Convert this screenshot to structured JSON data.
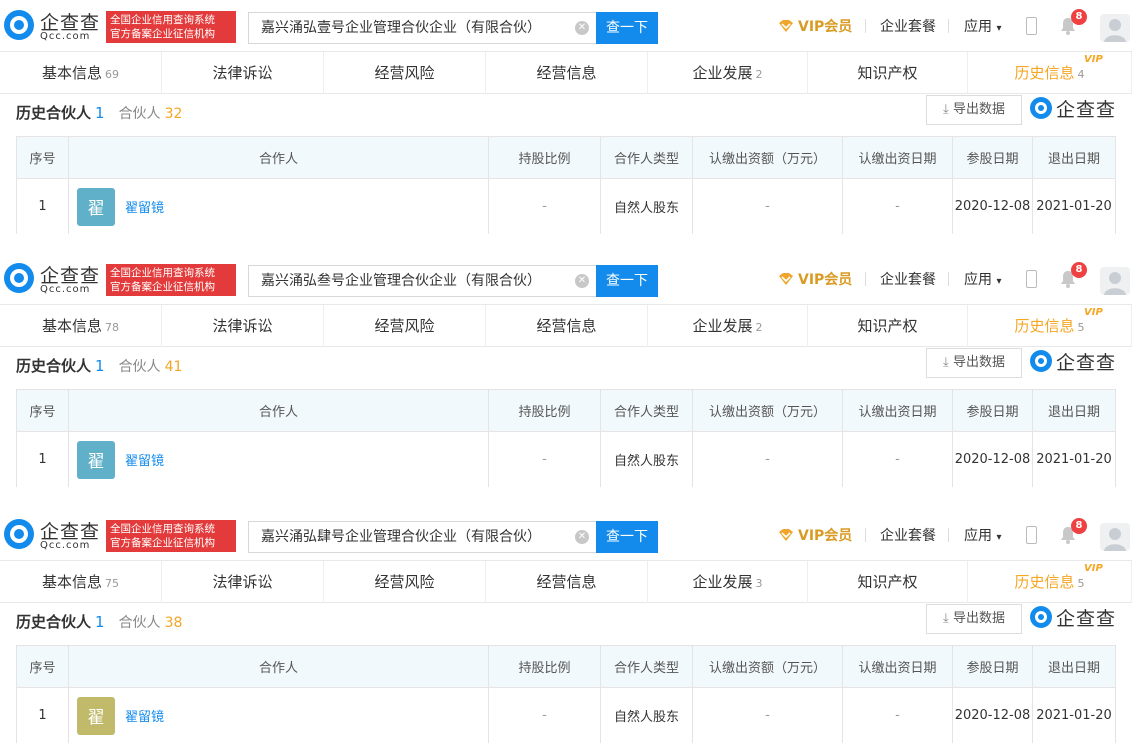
{
  "common": {
    "logo_cn": "企查查",
    "logo_en": "Qcc.com",
    "cert_line1": "全国企业信用查询系统",
    "cert_line2": "官方备案企业征信机构",
    "search_button": "查一下",
    "vip_label": "VIP会员",
    "package_link": "企业套餐",
    "apps_link": "应用",
    "notification_count": "8",
    "vip_sup": "VIP",
    "export_label": "导出数据",
    "watermark": "企查查",
    "section_title": "历史合伙人",
    "partners_label": "合伙人",
    "columns": [
      "序号",
      "合作人",
      "持股比例",
      "合作人类型",
      "认缴出资额（万元）",
      "认缴出资日期",
      "参股日期",
      "退出日期"
    ],
    "colors": {
      "brand_blue": "#128bed",
      "cert_red": "#e33b3b",
      "vip_gold": "#d89b23",
      "active_orange": "#f5a623"
    }
  },
  "panels": [
    {
      "search_value": "嘉兴涌弘壹号企业管理合伙企业（有限合伙）",
      "tabs": [
        {
          "label": "基本信息",
          "count": "69"
        },
        {
          "label": "法律诉讼",
          "count": ""
        },
        {
          "label": "经营风险",
          "count": ""
        },
        {
          "label": "经营信息",
          "count": ""
        },
        {
          "label": "企业发展",
          "count": "2"
        },
        {
          "label": "知识产权",
          "count": ""
        },
        {
          "label": "历史信息",
          "count": "4"
        }
      ],
      "history_count": "1",
      "partner_count": "32",
      "row": {
        "index": "1",
        "avatar_char": "翟",
        "avatar_color": "#5fb0c8",
        "name": "翟留镜",
        "ratio": "-",
        "type": "自然人股东",
        "amount": "-",
        "date": "-",
        "join_date": "2020-12-08",
        "exit_date": "2021-01-20"
      }
    },
    {
      "search_value": "嘉兴涌弘叁号企业管理合伙企业（有限合伙）",
      "tabs": [
        {
          "label": "基本信息",
          "count": "78"
        },
        {
          "label": "法律诉讼",
          "count": ""
        },
        {
          "label": "经营风险",
          "count": ""
        },
        {
          "label": "经营信息",
          "count": ""
        },
        {
          "label": "企业发展",
          "count": "2"
        },
        {
          "label": "知识产权",
          "count": ""
        },
        {
          "label": "历史信息",
          "count": "5"
        }
      ],
      "history_count": "1",
      "partner_count": "41",
      "row": {
        "index": "1",
        "avatar_char": "翟",
        "avatar_color": "#5fb0c8",
        "name": "翟留镜",
        "ratio": "-",
        "type": "自然人股东",
        "amount": "-",
        "date": "-",
        "join_date": "2020-12-08",
        "exit_date": "2021-01-20"
      }
    },
    {
      "search_value": "嘉兴涌弘肆号企业管理合伙企业（有限合伙）",
      "tabs": [
        {
          "label": "基本信息",
          "count": "75"
        },
        {
          "label": "法律诉讼",
          "count": ""
        },
        {
          "label": "经营风险",
          "count": ""
        },
        {
          "label": "经营信息",
          "count": ""
        },
        {
          "label": "企业发展",
          "count": "3"
        },
        {
          "label": "知识产权",
          "count": ""
        },
        {
          "label": "历史信息",
          "count": "5"
        }
      ],
      "history_count": "1",
      "partner_count": "38",
      "row": {
        "index": "1",
        "avatar_char": "翟",
        "avatar_color": "#c2ba6b",
        "name": "翟留镜",
        "ratio": "-",
        "type": "自然人股东",
        "amount": "-",
        "date": "-",
        "join_date": "2020-12-08",
        "exit_date": "2021-01-20"
      }
    }
  ]
}
